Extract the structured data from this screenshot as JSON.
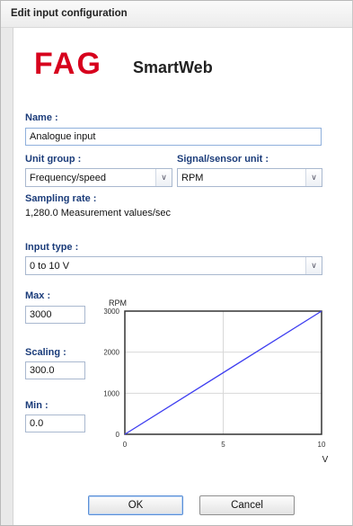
{
  "window": {
    "title": "Edit input configuration"
  },
  "logo": {
    "brand": "FAG",
    "product": "SmartWeb"
  },
  "colors": {
    "brand_red": "#d7001d",
    "label_blue": "#1b3c7a",
    "line": "#3d3df0"
  },
  "form": {
    "name_label": "Name :",
    "name_value": "Analogue input",
    "unit_group_label": "Unit group :",
    "unit_group_value": "Frequency/speed",
    "signal_label": "Signal/sensor unit :",
    "signal_value": "RPM",
    "sampling_label": "Sampling rate :",
    "sampling_value": "1,280.0 Measurement values/sec",
    "input_type_label": "Input type :",
    "input_type_value": "0 to 10 V",
    "max_label": "Max :",
    "max_value": "3000",
    "scaling_label": "Scaling :",
    "scaling_value": "300.0",
    "min_label": "Min :",
    "min_value": "0.0"
  },
  "chart_data": {
    "type": "line",
    "ylabel": "RPM",
    "xlabel": "V",
    "xlim": [
      0,
      10
    ],
    "ylim": [
      0,
      3000
    ],
    "xticks": [
      "0",
      "5",
      "10"
    ],
    "yticks": [
      "0",
      "1000",
      "2000",
      "3000"
    ],
    "grid": true,
    "series": [
      {
        "x": [
          0,
          10
        ],
        "y": [
          0,
          3000
        ]
      }
    ]
  },
  "buttons": {
    "ok": "OK",
    "cancel": "Cancel"
  },
  "icons": {
    "dropdown": "chevron-down-icon"
  }
}
